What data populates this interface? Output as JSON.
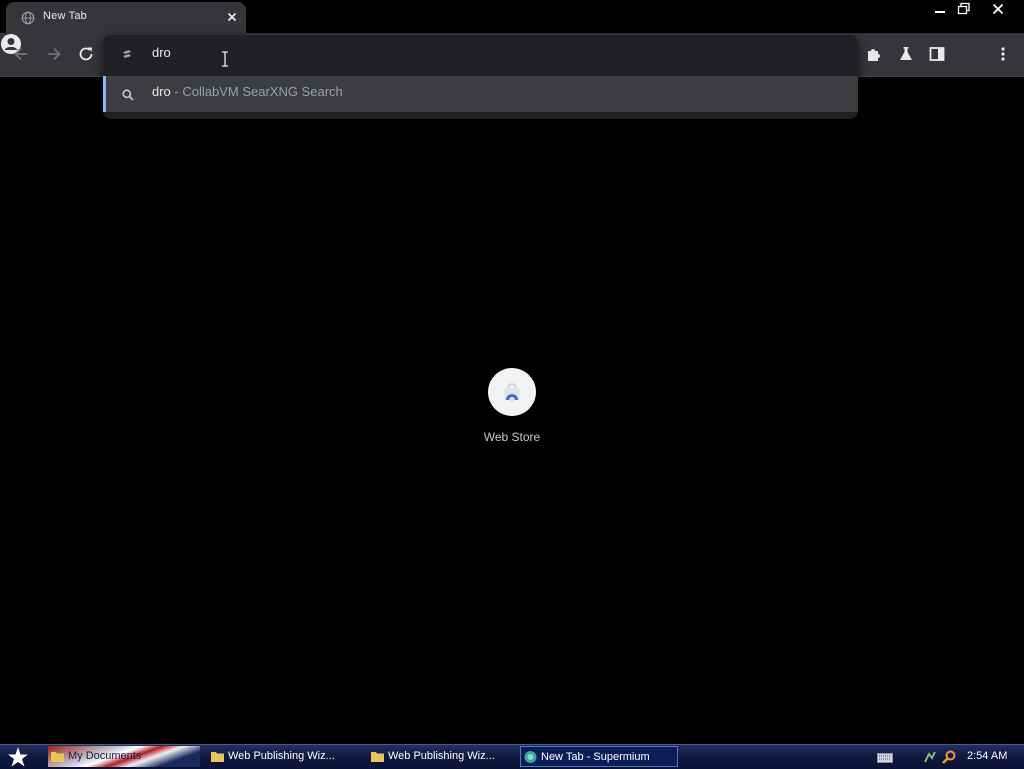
{
  "tab": {
    "title": "New Tab",
    "favicon": "globe-icon",
    "close_icon": "close-icon"
  },
  "window_controls": {
    "minimize": "minimize-icon",
    "restore": "restore-icon",
    "close": "close-icon"
  },
  "toolbar": {
    "back": "back-arrow-icon",
    "forward": "forward-arrow-icon",
    "reload": "reload-icon",
    "extensions": "puzzle-icon",
    "labs": "flask-icon",
    "side_panel": "side-panel-icon",
    "profile": "profile-avatar-icon",
    "menu": "kebab-menu-icon"
  },
  "omnibox": {
    "input_value": "dro",
    "suggestion": {
      "query": "dro",
      "description": " - CollabVM SearXNG Search"
    }
  },
  "ntp": {
    "shortcut_label": "Web Store"
  },
  "taskbar": {
    "tasks": [
      {
        "label": "My Documents"
      },
      {
        "label": "Web Publishing Wiz..."
      },
      {
        "label": "Web Publishing Wiz..."
      },
      {
        "label": "New Tab - Supermium"
      }
    ],
    "clock": "2:54 AM"
  },
  "colors": {
    "toolbar": "#35363a",
    "dropdown": "#202124",
    "accent": "#8ab4f8",
    "taskbar": "#0e1840"
  }
}
